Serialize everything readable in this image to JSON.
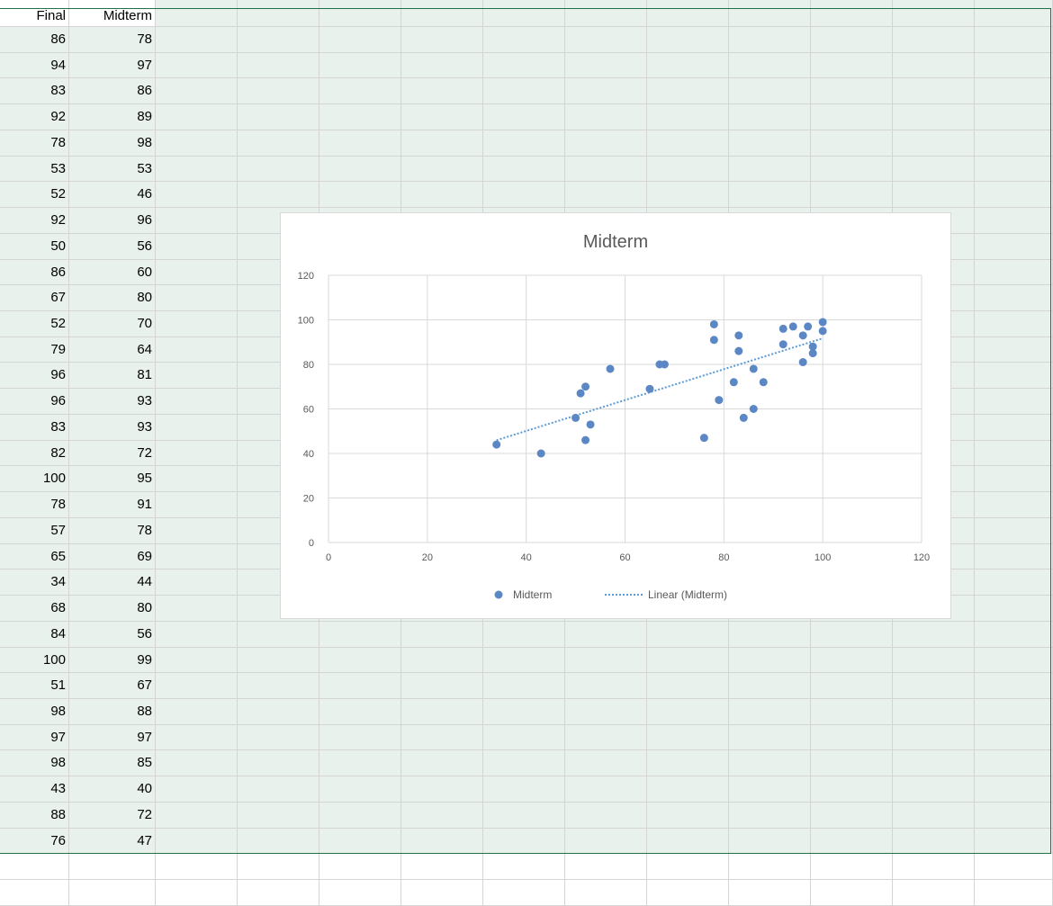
{
  "sheet": {
    "headers": {
      "final": "Final",
      "midterm": "Midterm"
    },
    "rows": [
      {
        "final": "86",
        "midterm": "78"
      },
      {
        "final": "94",
        "midterm": "97"
      },
      {
        "final": "83",
        "midterm": "86"
      },
      {
        "final": "92",
        "midterm": "89"
      },
      {
        "final": "78",
        "midterm": "98"
      },
      {
        "final": "53",
        "midterm": "53"
      },
      {
        "final": "52",
        "midterm": "46"
      },
      {
        "final": "92",
        "midterm": "96"
      },
      {
        "final": "50",
        "midterm": "56"
      },
      {
        "final": "86",
        "midterm": "60"
      },
      {
        "final": "67",
        "midterm": "80"
      },
      {
        "final": "52",
        "midterm": "70"
      },
      {
        "final": "79",
        "midterm": "64"
      },
      {
        "final": "96",
        "midterm": "81"
      },
      {
        "final": "96",
        "midterm": "93"
      },
      {
        "final": "83",
        "midterm": "93"
      },
      {
        "final": "82",
        "midterm": "72"
      },
      {
        "final": "100",
        "midterm": "95"
      },
      {
        "final": "78",
        "midterm": "91"
      },
      {
        "final": "57",
        "midterm": "78"
      },
      {
        "final": "65",
        "midterm": "69"
      },
      {
        "final": "34",
        "midterm": "44"
      },
      {
        "final": "68",
        "midterm": "80"
      },
      {
        "final": "84",
        "midterm": "56"
      },
      {
        "final": "100",
        "midterm": "99"
      },
      {
        "final": "51",
        "midterm": "67"
      },
      {
        "final": "98",
        "midterm": "88"
      },
      {
        "final": "97",
        "midterm": "97"
      },
      {
        "final": "98",
        "midterm": "85"
      },
      {
        "final": "43",
        "midterm": "40"
      },
      {
        "final": "88",
        "midterm": "72"
      },
      {
        "final": "76",
        "midterm": "47"
      }
    ],
    "selection_color": "#e8f1ec",
    "selection_border": "#217346"
  },
  "chart_data": {
    "type": "scatter",
    "title": "Midterm",
    "xlabel": "",
    "ylabel": "",
    "xlim": [
      0,
      120
    ],
    "ylim": [
      0,
      120
    ],
    "xticks": [
      "0",
      "20",
      "40",
      "60",
      "80",
      "100",
      "120"
    ],
    "yticks": [
      "0",
      "20",
      "40",
      "60",
      "80",
      "100",
      "120"
    ],
    "grid": true,
    "legend_position": "bottom",
    "series": [
      {
        "name": "Midterm",
        "color": "#5b87c5",
        "x": [
          86,
          94,
          83,
          92,
          78,
          53,
          52,
          92,
          50,
          86,
          67,
          52,
          79,
          96,
          96,
          83,
          82,
          100,
          78,
          57,
          65,
          34,
          68,
          84,
          100,
          51,
          98,
          97,
          98,
          43,
          88,
          76
        ],
        "y": [
          78,
          97,
          86,
          89,
          98,
          53,
          46,
          96,
          56,
          60,
          80,
          70,
          64,
          81,
          93,
          93,
          72,
          95,
          91,
          78,
          69,
          44,
          80,
          56,
          99,
          67,
          88,
          97,
          85,
          40,
          72,
          47
        ]
      }
    ],
    "trendline": {
      "name": "Linear (Midterm)",
      "kind": "linear",
      "style": "dotted",
      "color": "#5b9bd5"
    }
  }
}
